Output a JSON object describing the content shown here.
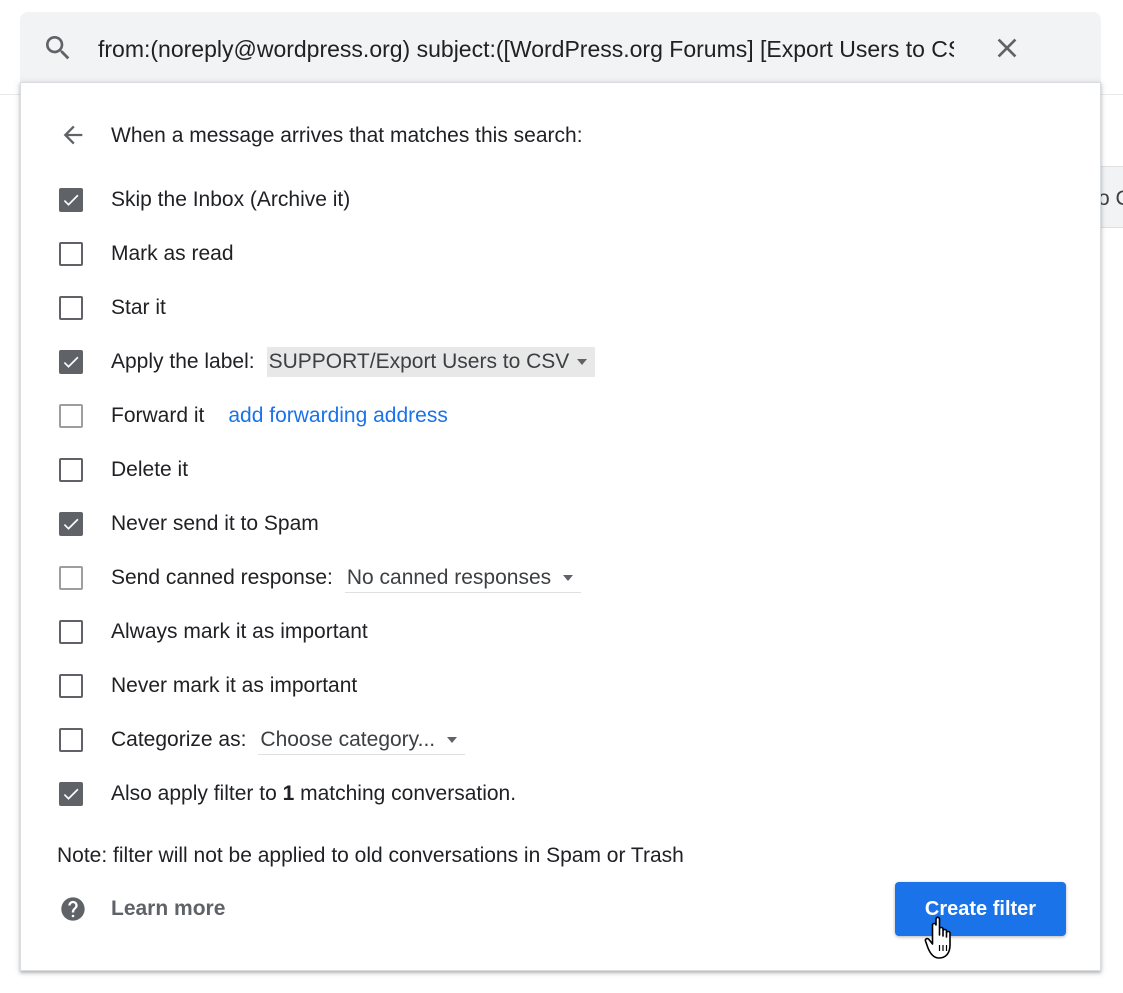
{
  "background": {
    "partial_text": "o C"
  },
  "search": {
    "query": "from:(noreply@wordpress.org) subject:([WordPress.org Forums] [Export Users to CSV])",
    "search_icon": "search-icon",
    "clear_icon": "close-icon"
  },
  "panel": {
    "back_icon": "arrow-back-icon",
    "header": "When a message arrives that matches this search:",
    "options": {
      "skip_inbox": {
        "label": "Skip the Inbox (Archive it)",
        "checked": true
      },
      "mark_read": {
        "label": "Mark as read",
        "checked": false
      },
      "star": {
        "label": "Star it",
        "checked": false
      },
      "apply_label": {
        "label": "Apply the label:",
        "checked": true,
        "value": "SUPPORT/Export Users to CSV"
      },
      "forward": {
        "label": "Forward it",
        "checked": false,
        "disabled": true,
        "link": "add forwarding address"
      },
      "delete": {
        "label": "Delete it",
        "checked": false
      },
      "never_spam": {
        "label": "Never send it to Spam",
        "checked": true
      },
      "canned": {
        "label": "Send canned response:",
        "checked": false,
        "disabled": true,
        "value": "No canned responses"
      },
      "always_important": {
        "label": "Always mark it as important",
        "checked": false
      },
      "never_important": {
        "label": "Never mark it as important",
        "checked": false
      },
      "categorize": {
        "label": "Categorize as:",
        "checked": false,
        "value": "Choose category..."
      },
      "also_apply": {
        "label_prefix": "Also apply filter to",
        "count": "1",
        "label_suffix": "matching conversation.",
        "checked": true
      }
    },
    "note": "Note: filter will not be applied to old conversations in Spam or Trash",
    "learn_more": "Learn more",
    "help_icon": "help-icon",
    "create_button": "Create filter"
  },
  "colors": {
    "accent": "#1a73e8",
    "checkbox_checked": "#5f6368",
    "search_bg": "#f1f3f4"
  }
}
